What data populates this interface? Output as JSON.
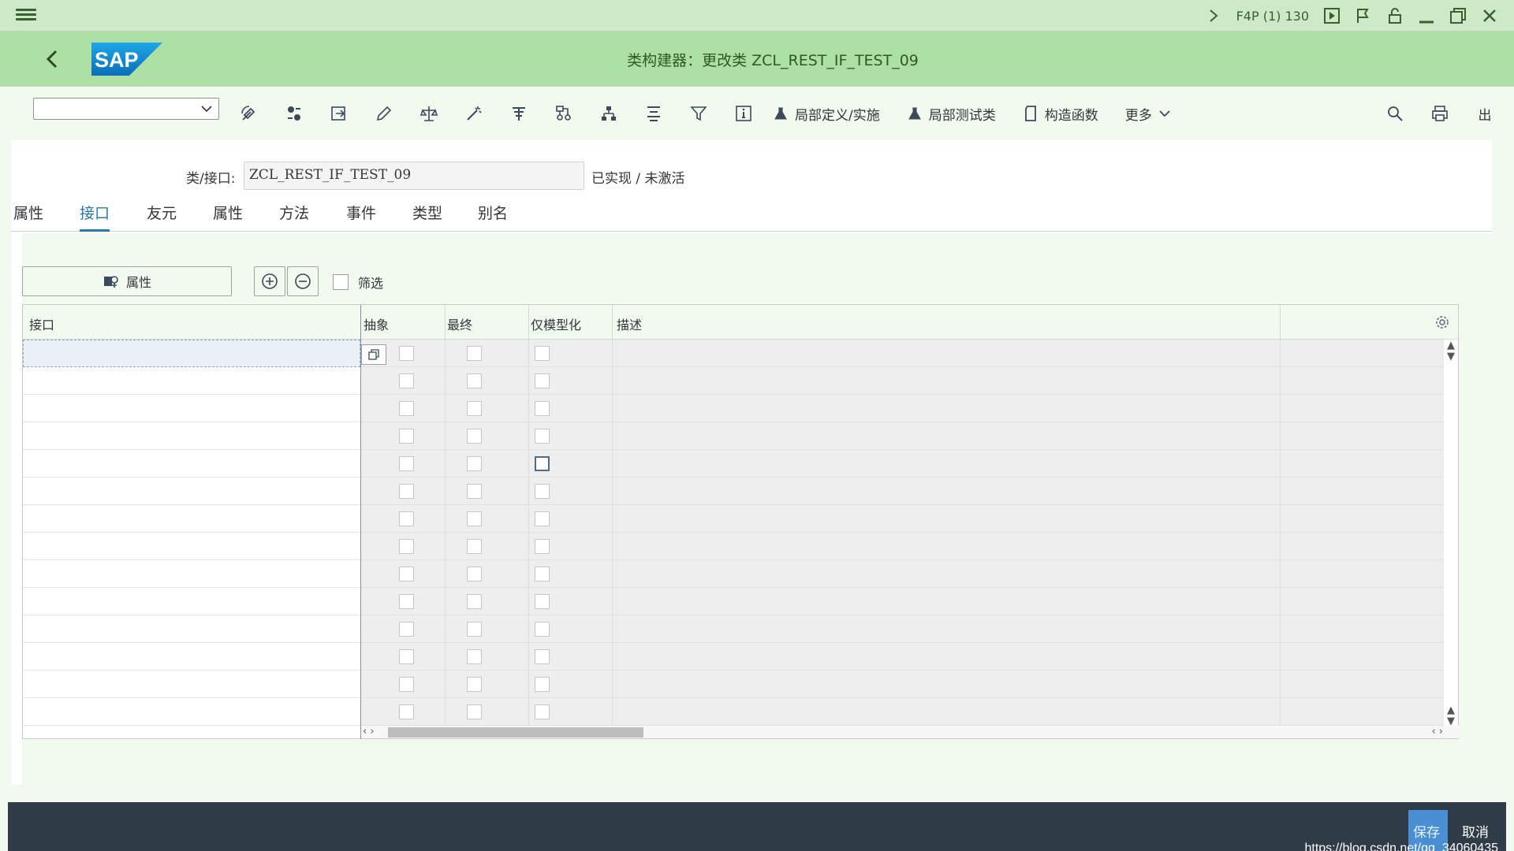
{
  "shell": {
    "system_info": "F4P (1) 130",
    "icons": [
      "menu-icon",
      "chevron-right-icon",
      "play-icon",
      "flag-icon",
      "unlock-icon",
      "minimize-icon",
      "maximize-icon",
      "close-icon"
    ]
  },
  "titlebar": {
    "title": "类构建器：更改类 ZCL_REST_IF_TEST_09",
    "logo_text": "SAP"
  },
  "toolbar": {
    "dropdown_value": "",
    "local_def_label": "局部定义/实施",
    "local_test_label": "局部测试类",
    "constructor_label": "构造函数",
    "more_label": "更多",
    "exit_label": "出"
  },
  "form": {
    "class_label": "类/接口:",
    "class_value": "ZCL_REST_IF_TEST_09",
    "status": "已实现 / 未激活"
  },
  "tabs": [
    {
      "label": "属性",
      "active": false
    },
    {
      "label": "接口",
      "active": true
    },
    {
      "label": "友元",
      "active": false
    },
    {
      "label": "属性",
      "active": false
    },
    {
      "label": "方法",
      "active": false
    },
    {
      "label": "事件",
      "active": false
    },
    {
      "label": "类型",
      "active": false
    },
    {
      "label": "别名",
      "active": false
    }
  ],
  "actions": {
    "attributes_button": "属性",
    "filter_label": "筛选"
  },
  "table": {
    "columns": [
      "接口",
      "抽象",
      "最终",
      "仅模型化",
      "描述"
    ],
    "row_count": 14,
    "focused_row": 4
  },
  "footer": {
    "save_label": "保存",
    "cancel_label": "取消",
    "watermark": "https://blog.csdn.net/qq_34060435"
  },
  "colors": {
    "shell_bg": "#cde9c8",
    "title_bg": "#aedfa4",
    "accent_tab": "#2a7aa8",
    "footer_bg": "#2f3b47",
    "save_btn": "#4a8fd4"
  }
}
